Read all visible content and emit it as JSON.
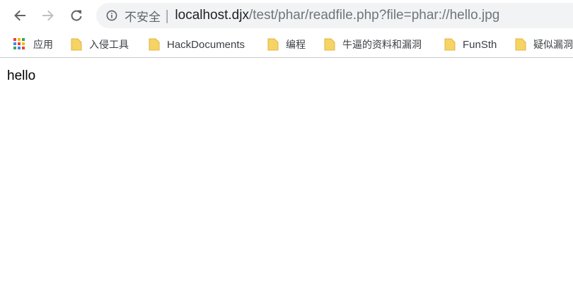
{
  "toolbar": {
    "back_icon": "arrow-left-icon",
    "forward_icon": "arrow-right-icon",
    "reload_icon": "reload-icon"
  },
  "omnibox": {
    "info_icon": "info-icon",
    "security_label": "不安全",
    "separator": "|",
    "url_host": "localhost.djx",
    "url_path": "/test/phar/readfile.php?file=phar://hello.jpg"
  },
  "bookmarks": {
    "apps_label": "应用",
    "items": [
      {
        "label": "入侵工具",
        "icon": "folder-icon"
      },
      {
        "label": "HackDocuments",
        "icon": "folder-icon"
      },
      {
        "label": "编程",
        "icon": "folder-icon"
      },
      {
        "label": "牛逼的资料和漏洞",
        "icon": "folder-icon"
      },
      {
        "label": "FunSth",
        "icon": "folder-icon"
      },
      {
        "label": "疑似漏洞",
        "icon": "folder-icon"
      }
    ],
    "apps_colors": [
      "#ea4335",
      "#fbbc04",
      "#34a853",
      "#4285f4",
      "#ea4335",
      "#fbbc04",
      "#34a853",
      "#4285f4",
      "#ea4335"
    ],
    "folder_color": "#f6d365"
  },
  "page": {
    "body_text": "hello"
  }
}
